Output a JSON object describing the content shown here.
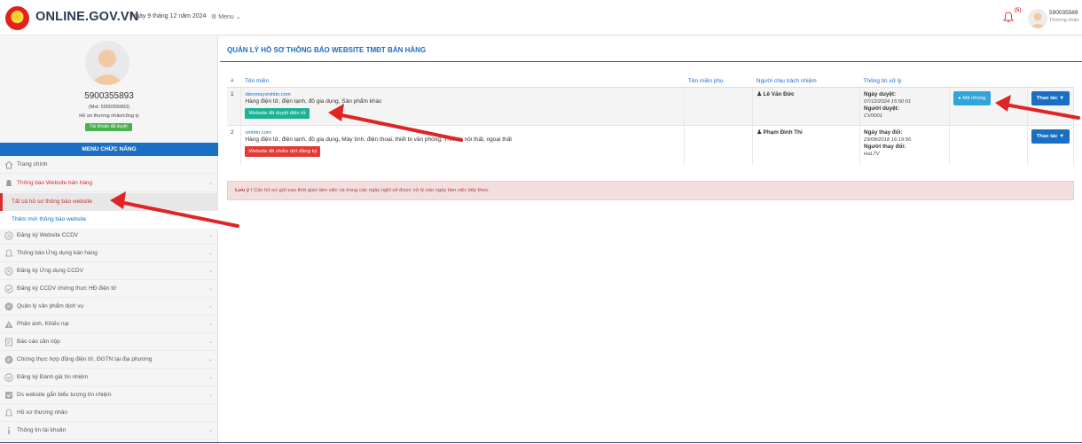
{
  "header": {
    "site_title": "ONLINE.GOV.VN",
    "date": "Ngày 9 tháng 12 năm 2024",
    "menu_label": "Menu",
    "notification_count": "(5)",
    "user_id": "590035589",
    "user_role": "Thương nhân"
  },
  "sidebar": {
    "user_id": "5900355893",
    "mst": "(Mst: 5900355893)",
    "role": "Hồ sơ thương nhân/công ty",
    "account_status": "Tài khoản đã duyệt",
    "menu_header": "MENU CHỨC NĂNG",
    "items": [
      {
        "label": "Trang chính",
        "icon": "home-icon"
      },
      {
        "label": "Thông báo Website bán hàng",
        "icon": "bell-icon"
      },
      {
        "label": "Tất cả hồ sơ thông báo website",
        "icon": ""
      },
      {
        "label": "Thêm mới thông báo website",
        "icon": ""
      },
      {
        "label": "Đăng ký Website CCDV",
        "icon": "registered-icon"
      },
      {
        "label": "Thông báo Ứng dụng bán hàng",
        "icon": "bell-icon"
      },
      {
        "label": "Đăng ký Ứng dụng CCDV",
        "icon": "registered-icon"
      },
      {
        "label": "Đăng ký CCDV chứng thực HĐ điện tử",
        "icon": "check-circle-icon"
      },
      {
        "label": "Quản lý sản phẩm dịch vụ",
        "icon": "p-circle-icon"
      },
      {
        "label": "Phản ánh, Khiếu nại",
        "icon": "warning-icon"
      },
      {
        "label": "Báo cáo cần nộp",
        "icon": "document-icon"
      },
      {
        "label": "Chứng thực hợp đồng điện tử, ĐGTN tại địa phương",
        "icon": "p-circle-icon"
      },
      {
        "label": "Đăng ký Đánh giá tín nhiệm",
        "icon": "check-circle-icon"
      },
      {
        "label": "Ds website gắn biểu tượng tín nhiệm",
        "icon": "checkbox-icon"
      },
      {
        "label": "Hồ sơ thương nhân",
        "icon": "bell-icon"
      },
      {
        "label": "Thông tin tài khoản",
        "icon": "info-icon"
      }
    ]
  },
  "main": {
    "title": "QUẢN LÝ HỒ SƠ THÔNG BÁO WEBSITE TMĐT BÁN HÀNG",
    "columns": [
      "#",
      "Tên miền",
      "Tên miền phụ",
      "Người chịu trách nhiệm",
      "Thông tin xử lý",
      "",
      ""
    ],
    "rows": [
      {
        "no": "1",
        "domain": "dienmayvinhtin.com",
        "description": "Hàng điện tử, điện lạnh, đồ gia dụng, Sản phẩm khác",
        "status": "Website đã duyệt điện tử",
        "subdomain": "",
        "person": "Lê Văn Đức",
        "info_label_1": "Ngày duyệt:",
        "info_value_1": "07/12/2024 15:50:01",
        "info_label_2": "Người duyệt:",
        "info_value_2": "CV0001",
        "embed_button": "Mã nhúng",
        "action_button": "Thao tác"
      },
      {
        "no": "2",
        "domain": "vinhtin.com",
        "description": "Hàng điện tử, điện lạnh, đồ gia dụng, Máy tính, điện thoại, thiết bị văn phòng, Thiết bị nội thất, ngoại thất",
        "status": "Website đã chấm dứt đăng ký",
        "subdomain": "",
        "person": "Phạm Đình Thi",
        "info_label_1": "Ngày thay đổi:",
        "info_value_1": "23/08/2018 16:19:56",
        "info_label_2": "Người thay đổi:",
        "info_value_2": "HaLTV",
        "action_button": "Thao tác"
      }
    ],
    "notice_label": "Lưu ý !",
    "notice_text": " Các hồ sơ gửi sau thời gian làm việc và trong các ngày nghỉ sẽ được xử lý vào ngày làm việc tiếp theo."
  },
  "colors": {
    "primary": "#1a6fc4",
    "success": "#1bb394",
    "danger": "#e53935",
    "info": "#2fa5d9",
    "annotation": "#e02424"
  }
}
